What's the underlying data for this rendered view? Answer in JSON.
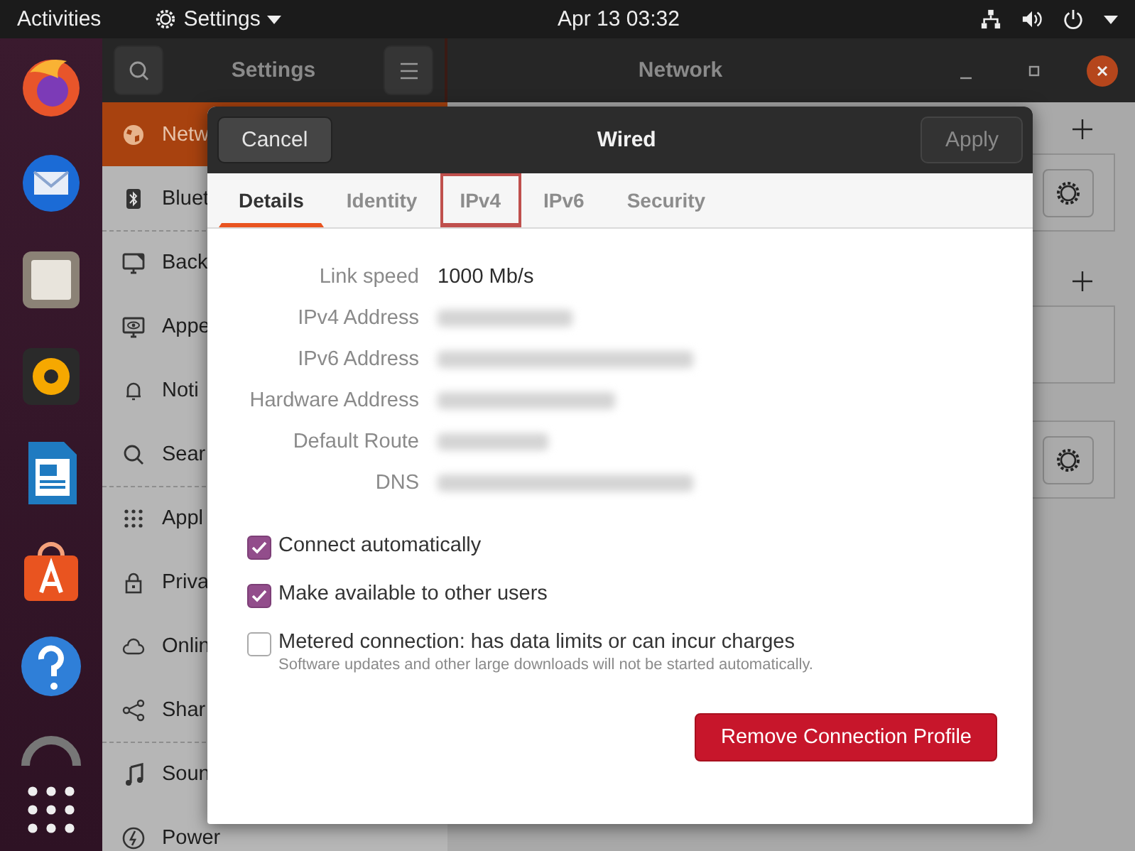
{
  "top_bar": {
    "activities": "Activities",
    "app_menu": "Settings",
    "clock": "Apr 13  03:32"
  },
  "settings_window": {
    "sidebar_title": "Settings",
    "page_title": "Network",
    "sidebar": {
      "items": [
        {
          "label": "Netw",
          "kind": "globe",
          "selected": true,
          "separator_before": false
        },
        {
          "label": "Bluet",
          "kind": "bluetooth",
          "selected": false,
          "separator_before": false
        },
        {
          "label": "Back",
          "kind": "monitor",
          "selected": false,
          "separator_before": true
        },
        {
          "label": "Appe",
          "kind": "appearance",
          "selected": false,
          "separator_before": false
        },
        {
          "label": "Noti",
          "kind": "bell",
          "selected": false,
          "separator_before": false
        },
        {
          "label": "Sear",
          "kind": "search",
          "selected": false,
          "separator_before": false
        },
        {
          "label": "Appl",
          "kind": "grid",
          "selected": false,
          "separator_before": true
        },
        {
          "label": "Priva",
          "kind": "lock",
          "selected": false,
          "separator_before": false
        },
        {
          "label": "Onlin",
          "kind": "cloud",
          "selected": false,
          "separator_before": false
        },
        {
          "label": "Shar",
          "kind": "share",
          "selected": false,
          "separator_before": false
        },
        {
          "label": "Soun",
          "kind": "music",
          "selected": false,
          "separator_before": true
        },
        {
          "label": "Power",
          "kind": "power",
          "selected": false,
          "separator_before": false
        }
      ]
    }
  },
  "dialog": {
    "title": "Wired",
    "cancel": "Cancel",
    "apply": {
      "label": "Apply",
      "disabled": true
    },
    "tabs": [
      {
        "label": "Details",
        "selected": true,
        "highlighted": false
      },
      {
        "label": "Identity",
        "selected": false,
        "highlighted": false
      },
      {
        "label": "IPv4",
        "selected": false,
        "highlighted": true
      },
      {
        "label": "IPv6",
        "selected": false,
        "highlighted": false
      },
      {
        "label": "Security",
        "selected": false,
        "highlighted": false
      }
    ],
    "details": [
      {
        "label": "Link speed",
        "value": "1000 Mb/s",
        "redacted": false
      },
      {
        "label": "IPv4 Address",
        "redacted": true
      },
      {
        "label": "IPv6 Address",
        "redacted": true
      },
      {
        "label": "Hardware Address",
        "redacted": true
      },
      {
        "label": "Default Route",
        "redacted": true
      },
      {
        "label": "DNS",
        "redacted": true
      }
    ],
    "options": [
      {
        "label": "Connect automatically",
        "checked": true
      },
      {
        "label": "Make available to other users",
        "checked": true
      },
      {
        "label": "Metered connection: has data limits or can incur charges",
        "checked": false,
        "hint": "Software updates and other large downloads will not be started automatically."
      }
    ],
    "remove_button": "Remove Connection Profile"
  }
}
